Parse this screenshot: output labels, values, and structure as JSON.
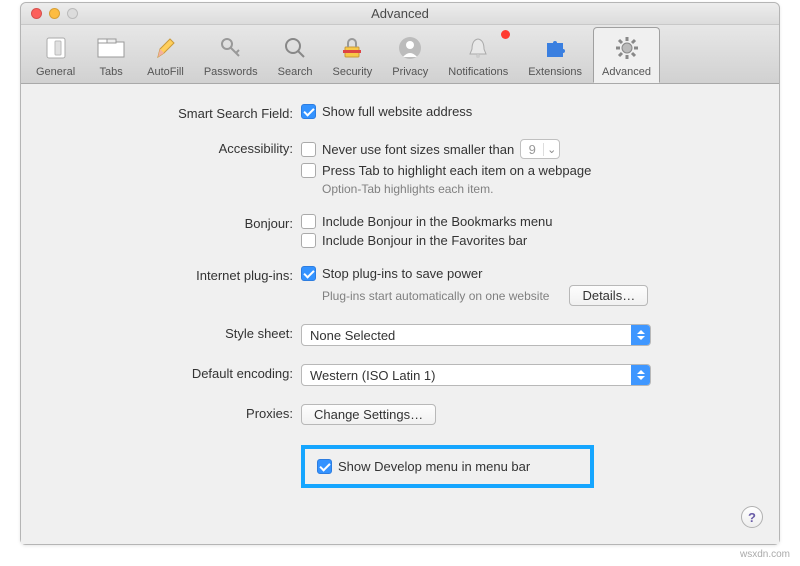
{
  "window": {
    "title": "Advanced"
  },
  "toolbar": {
    "items": [
      {
        "label": "General"
      },
      {
        "label": "Tabs"
      },
      {
        "label": "AutoFill"
      },
      {
        "label": "Passwords"
      },
      {
        "label": "Search"
      },
      {
        "label": "Security"
      },
      {
        "label": "Privacy"
      },
      {
        "label": "Notifications"
      },
      {
        "label": "Extensions"
      },
      {
        "label": "Advanced"
      }
    ]
  },
  "smartSearch": {
    "label": "Smart Search Field:",
    "showFull": "Show full website address"
  },
  "accessibility": {
    "label": "Accessibility:",
    "neverSmaller": "Never use font sizes smaller than",
    "fontSize": "9",
    "pressTab": "Press Tab to highlight each item on a webpage",
    "hint": "Option-Tab highlights each item."
  },
  "bonjour": {
    "label": "Bonjour:",
    "bookmarks": "Include Bonjour in the Bookmarks menu",
    "favorites": "Include Bonjour in the Favorites bar"
  },
  "plugins": {
    "label": "Internet plug-ins:",
    "stop": "Stop plug-ins to save power",
    "hint": "Plug-ins start automatically on one website",
    "details": "Details…"
  },
  "stylesheet": {
    "label": "Style sheet:",
    "value": "None Selected"
  },
  "encoding": {
    "label": "Default encoding:",
    "value": "Western (ISO Latin 1)"
  },
  "proxies": {
    "label": "Proxies:",
    "button": "Change Settings…"
  },
  "develop": {
    "label": "Show Develop menu in menu bar"
  },
  "help": "?"
}
